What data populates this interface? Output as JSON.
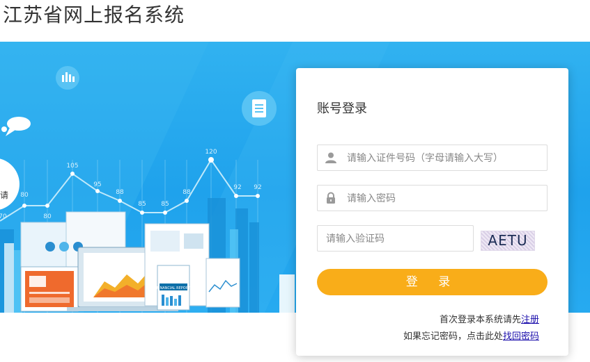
{
  "header": {
    "title": "江苏省网上报名系统"
  },
  "banner": {
    "chart_labels": [
      "70",
      "80",
      "80",
      "105",
      "95",
      "88",
      "85",
      "85",
      "88",
      "120",
      "92",
      "92"
    ],
    "report_label": "FINANCIAL REPORT",
    "bubble_text": "请"
  },
  "login": {
    "title": "账号登录",
    "id_placeholder": "请输入证件号码（字母请输入大写）",
    "password_placeholder": "请输入密码",
    "captcha_placeholder": "请输入验证码",
    "captcha_text": "AETU",
    "submit_label": "登 录",
    "register_prefix": "首次登录本系统请先",
    "register_link": "注册",
    "forgot_prefix": "如果忘记密码，点击此处",
    "forgot_link": "找回密码"
  },
  "colors": {
    "banner_blue": "#27aaf0",
    "button_orange": "#f9ad19",
    "link_blue": "#1a0dab"
  },
  "icons": [
    "user-icon",
    "lock-icon",
    "chat-icon",
    "bar-chart-icon",
    "document-icon"
  ]
}
